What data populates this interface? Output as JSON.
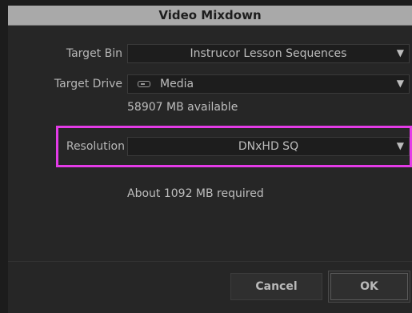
{
  "window": {
    "title": "Video Mixdown"
  },
  "fields": {
    "target_bin": {
      "label": "Target Bin",
      "value": "Instrucor Lesson Sequences"
    },
    "target_drive": {
      "label": "Target Drive",
      "value": "Media",
      "icon": "drive-icon",
      "available": "58907 MB available"
    },
    "resolution": {
      "label": "Resolution",
      "value": "DNxHD SQ"
    }
  },
  "required": "About 1092 MB required",
  "buttons": {
    "cancel": "Cancel",
    "ok": "OK"
  },
  "colors": {
    "highlight": "#e33be7"
  }
}
